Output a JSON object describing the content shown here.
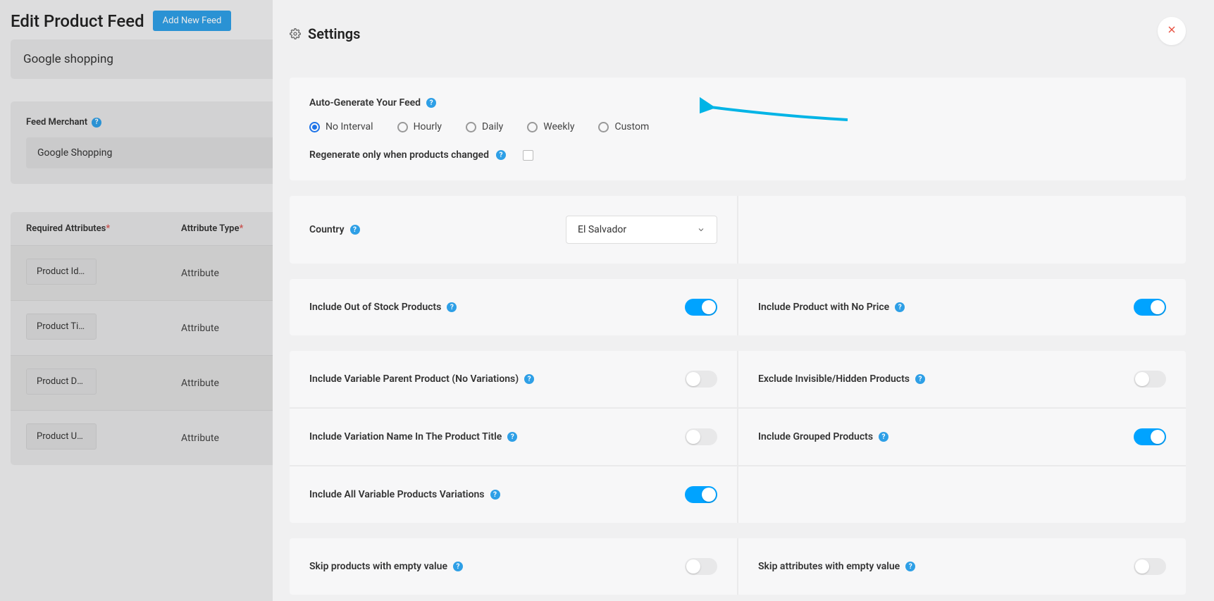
{
  "header": {
    "page_title": "Edit Product Feed",
    "add_button": "Add New Feed",
    "feed_name_value": "Google shopping"
  },
  "side": {
    "merchant_label": "Feed Merchant",
    "merchant_value": "Google Shopping",
    "attr_header_required": "Required Attributes",
    "attr_header_type": "Attribute Type",
    "rows": [
      {
        "tag": "Product Id [id]",
        "type": "Attribute"
      },
      {
        "tag": "Product Title …",
        "type": "Attribute"
      },
      {
        "tag": "Product Desc…",
        "type": "Attribute"
      },
      {
        "tag": "Product URL …",
        "type": "Attribute"
      }
    ]
  },
  "panel": {
    "title": "Settings",
    "autogen_label": "Auto-Generate Your Feed",
    "radios": {
      "no_interval": "No Interval",
      "hourly": "Hourly",
      "daily": "Daily",
      "weekly": "Weekly",
      "custom": "Custom",
      "selected": "no_interval"
    },
    "regen_label": "Regenerate only when products changed",
    "country_label": "Country",
    "country_value": "El Salvador",
    "settings": {
      "include_oos": "Include Out of Stock Products",
      "include_no_price": "Include Product with No Price",
      "include_var_parent": "Include Variable Parent Product (No Variations)",
      "exclude_hidden": "Exclude Invisible/Hidden Products",
      "include_var_name": "Include Variation Name In The Product Title",
      "include_grouped": "Include Grouped Products",
      "include_all_var": "Include All Variable Products Variations",
      "skip_empty_products": "Skip products with empty value",
      "skip_empty_attrs": "Skip attributes with empty value"
    },
    "toggles": {
      "include_oos": true,
      "include_no_price": true,
      "include_var_parent": false,
      "exclude_hidden": false,
      "include_var_name": false,
      "include_grouped": true,
      "include_all_var": true,
      "skip_empty_products": false,
      "skip_empty_attrs": false
    }
  }
}
